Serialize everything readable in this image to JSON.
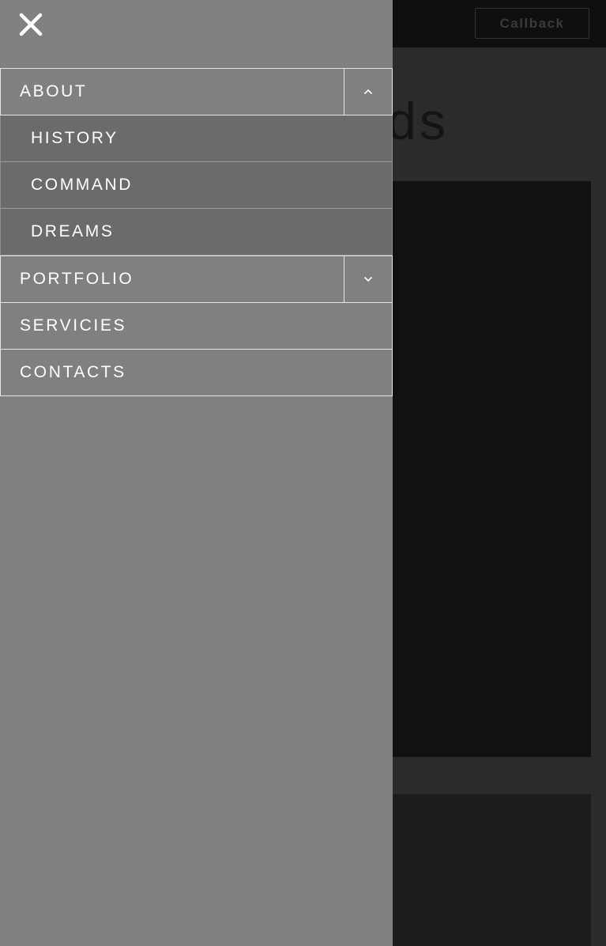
{
  "header": {
    "callback_label": "Callback"
  },
  "background": {
    "heading_fragment": "ds"
  },
  "menu": {
    "close_icon": "close-icon",
    "items": [
      {
        "label": "ABOUT",
        "expanded": true,
        "toggle_icon": "chevron-up-icon",
        "children": [
          {
            "label": "HISTORY"
          },
          {
            "label": "COMMAND"
          },
          {
            "label": "DREAMS"
          }
        ]
      },
      {
        "label": "PORTFOLIO",
        "expanded": false,
        "toggle_icon": "chevron-down-icon"
      },
      {
        "label": "SERVICIES"
      },
      {
        "label": "CONTACTS"
      }
    ]
  },
  "colors": {
    "menu_bg": "#808080",
    "submenu_bg": "#6b6b6b",
    "text": "#ffffff"
  }
}
